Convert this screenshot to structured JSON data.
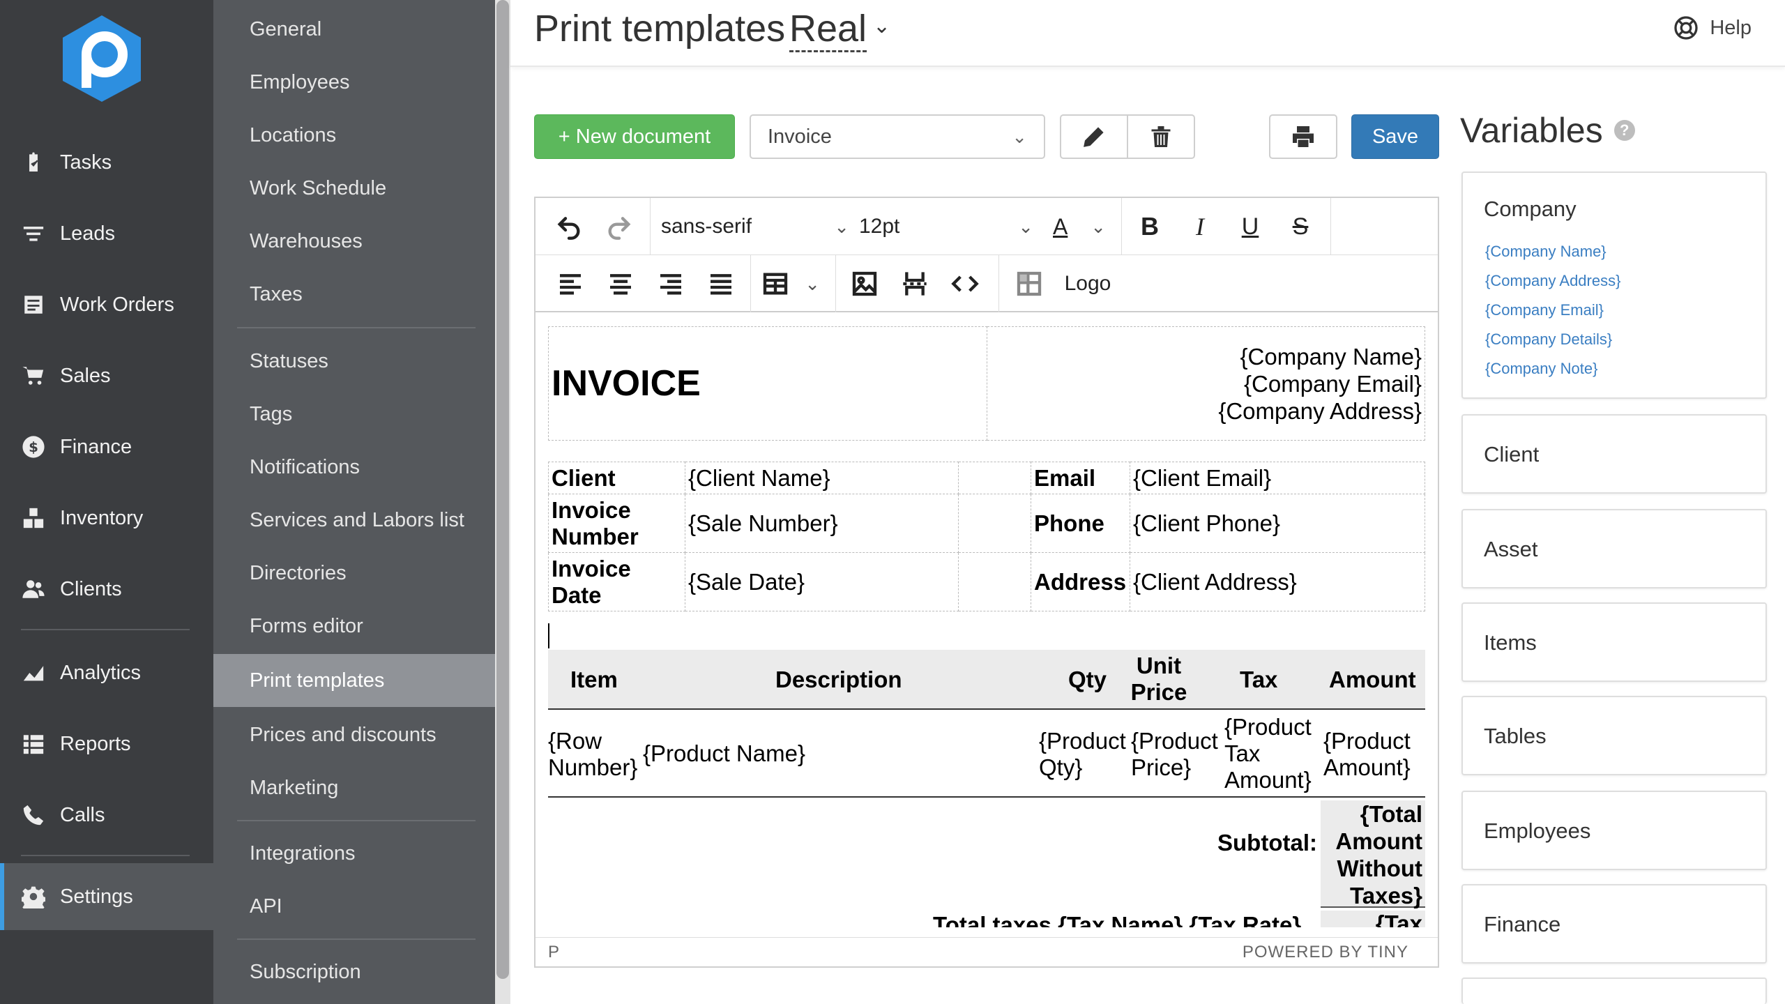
{
  "nav": {
    "items": [
      {
        "label": "Tasks",
        "icon": "clipboard-icon"
      },
      {
        "label": "Leads",
        "icon": "filter-icon"
      },
      {
        "label": "Work Orders",
        "icon": "work-orders-icon"
      },
      {
        "label": "Sales",
        "icon": "cart-icon"
      },
      {
        "label": "Finance",
        "icon": "dollar-icon"
      },
      {
        "label": "Inventory",
        "icon": "boxes-icon"
      },
      {
        "label": "Clients",
        "icon": "users-icon"
      },
      {
        "label": "Analytics",
        "icon": "chart-icon"
      },
      {
        "label": "Reports",
        "icon": "list-icon"
      },
      {
        "label": "Calls",
        "icon": "phone-icon"
      },
      {
        "label": "Settings",
        "icon": "gear-icon"
      }
    ]
  },
  "subnav": {
    "items": [
      "General",
      "Employees",
      "Locations",
      "Work Schedule",
      "Warehouses",
      "Taxes",
      "Statuses",
      "Tags",
      "Notifications",
      "Services and Labors list",
      "Directories",
      "Forms editor",
      "Print templates",
      "Prices and discounts",
      "Marketing",
      "Integrations",
      "API",
      "Subscription"
    ]
  },
  "header": {
    "title": "Print templates",
    "selected_template": "Real",
    "help_label": "Help"
  },
  "toolbar": {
    "new_document_label": "+ New document",
    "document_select_value": "Invoice",
    "save_label": "Save"
  },
  "editor": {
    "font_family": "sans-serif",
    "font_size": "12pt",
    "logo_label": "Logo",
    "status_path": "P",
    "powered_by": "POWERED BY TINY"
  },
  "document": {
    "title": "INVOICE",
    "company_lines": [
      "{Company Name}",
      "{Company Email}",
      "{Company Address}"
    ],
    "client_rows": [
      {
        "label": "Client",
        "value": "{Client Name}",
        "label2": "Email",
        "value2": "{Client Email}"
      },
      {
        "label": "Invoice Number",
        "value": "{Sale Number}",
        "label2": "Phone",
        "value2": "{Client Phone}"
      },
      {
        "label": "Invoice Date",
        "value": "{Sale Date}",
        "label2": "Address",
        "value2": "{Client Address}"
      }
    ],
    "item_headers": {
      "item": "Item",
      "description": "Description",
      "qty": "Qty",
      "unit_price": "Unit Price",
      "tax": "Tax",
      "amount": "Amount"
    },
    "item_row": {
      "item": "{Row Number}",
      "description": "{Product Name}",
      "qty": "{Product Qty}",
      "unit_price": "{Product Price}",
      "tax": "{Product Tax Amount}",
      "amount": "{Product Amount}"
    },
    "subtotal_label": "Subtotal:",
    "subtotal_value": "{Total Amount Without Taxes}",
    "taxes_label": "Total taxes {Tax Name} {Tax Rate}",
    "tax_value": "{Tax"
  },
  "variables": {
    "title": "Variables",
    "help_mark": "?",
    "groups": [
      {
        "name": "Company",
        "items": [
          "{Company Name}",
          "{Company Address}",
          "{Company Email}",
          "{Company Details}",
          "{Company Note}"
        ]
      },
      {
        "name": "Client"
      },
      {
        "name": "Asset"
      },
      {
        "name": "Items"
      },
      {
        "name": "Tables"
      },
      {
        "name": "Employees"
      },
      {
        "name": "Finance"
      }
    ]
  },
  "colors": {
    "nav_bg": "#3b3d40",
    "subnav_bg": "#55585c",
    "subnav_active": "#909398",
    "success": "#5cb85c",
    "primary": "#337ab7",
    "logo_blue": "#2d8fe0",
    "variable_link": "#3a7ec2"
  }
}
